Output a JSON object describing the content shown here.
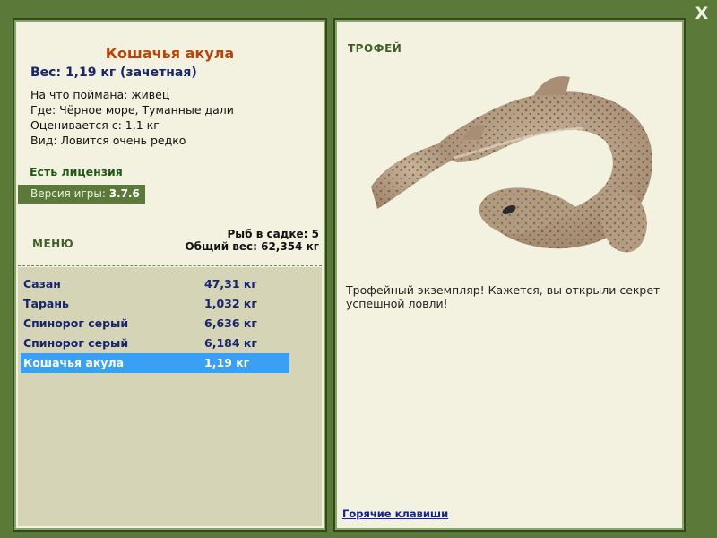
{
  "window": {
    "close_label": "X"
  },
  "fish": {
    "name": "Кошачья акула",
    "weight_line": "Вес: 1,19 кг (зачетная)",
    "info": [
      {
        "label": "На что поймана:",
        "value": "живец"
      },
      {
        "label": "Где:",
        "value": "Чёрное море, Туманные дали"
      },
      {
        "label": "Оценивается с:",
        "value": "1,1 кг"
      },
      {
        "label": "Вид:",
        "value": "Ловится очень редко"
      }
    ]
  },
  "license": "Есть лицензия",
  "version": {
    "label": "Версия игры:",
    "value": "3.7.6"
  },
  "menu_label": "МЕНЮ",
  "stats": {
    "count_line": "Рыб в садке: 5",
    "total_line": "Общий вес: 62,354 кг"
  },
  "cage": [
    {
      "name": "Сазан",
      "weight": "47,31 кг",
      "selected": false
    },
    {
      "name": "Тарань",
      "weight": "1,032 кг",
      "selected": false
    },
    {
      "name": "Спинорог серый",
      "weight": "6,636 кг",
      "selected": false
    },
    {
      "name": "Спинорог серый",
      "weight": "6,184 кг",
      "selected": false
    },
    {
      "name": "Кошачья акула",
      "weight": "1,19 кг",
      "selected": true
    }
  ],
  "trophy": {
    "label": "ТРОФЕЙ",
    "text": "Трофейный экземпляр! Кажется, вы открыли секрет успешной ловли!"
  },
  "hotkeys_label": "Горячие клавиши",
  "colors": {
    "frame": "#5b7a3a",
    "panel": "#f3f2e0",
    "title": "#b8440c",
    "navy": "#17246e",
    "selected": "#3aa0f5"
  }
}
